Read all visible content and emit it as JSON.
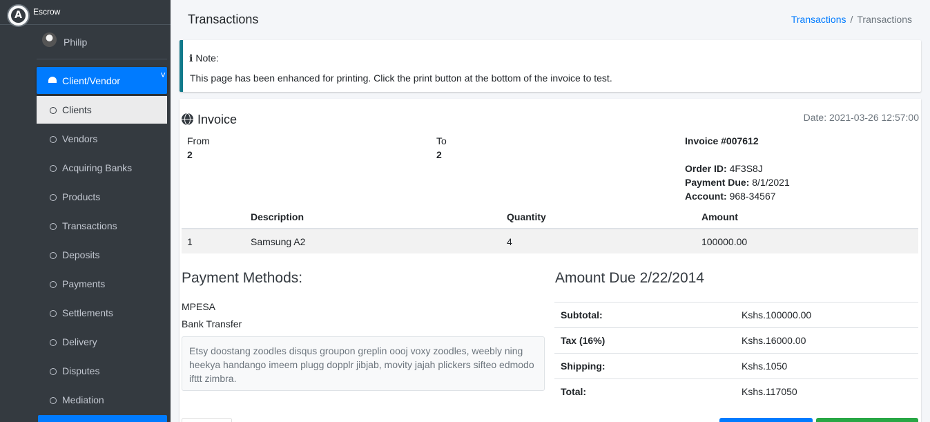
{
  "brand": {
    "name": "Escrow",
    "logo_letter": "A",
    "logo_icon": "app-logo-icon"
  },
  "user": {
    "name": "Philip",
    "avatar_icon": "user-avatar"
  },
  "nav": {
    "active": {
      "label": "Client/Vendor",
      "icon": "dashboard-gauge-icon",
      "chevron": "˅"
    },
    "items": [
      {
        "label": "Clients"
      },
      {
        "label": "Vendors"
      },
      {
        "label": "Acquiring Banks"
      },
      {
        "label": "Products"
      },
      {
        "label": "Transactions"
      },
      {
        "label": "Deposits"
      },
      {
        "label": "Payments"
      },
      {
        "label": "Settlements"
      },
      {
        "label": "Delivery"
      },
      {
        "label": "Disputes"
      },
      {
        "label": "Mediation"
      }
    ]
  },
  "header": {
    "title": "Transactions",
    "breadcrumb": {
      "link": "Transactions",
      "separator": "/",
      "current": "Transactions"
    }
  },
  "callout": {
    "icon": "info-icon",
    "icon_glyph": "i",
    "title": "Note:",
    "text": "This page has been enhanced for printing. Click the print button at the bottom of the invoice to test."
  },
  "invoice": {
    "title": "Invoice",
    "title_icon": "globe-icon",
    "date": "Date: 2021-03-26 12:57:00",
    "from_label": "From",
    "from_value": "2",
    "to_label": "To",
    "to_value": "2",
    "number": "Invoice #007612",
    "order_id_label": "Order ID:",
    "order_id": "4F3S8J",
    "payment_due_label": "Payment Due:",
    "payment_due": "8/1/2021",
    "account_label": "Account:",
    "account": "968-34567",
    "table": {
      "headers": [
        "",
        "Description",
        "Quantity",
        "Amount"
      ],
      "rows": [
        [
          "1",
          "Samsung A2",
          "4",
          "100000.00"
        ]
      ]
    }
  },
  "payment": {
    "title": "Payment Methods:",
    "methods": [
      "MPESA",
      "Bank Transfer"
    ],
    "note": "Etsy doostang zoodles disqus groupon greplin oooj voxy zoodles, weebly ning heekya handango imeem plugg dopplr jibjab, movity jajah plickers sifteo edmodo ifttt zimbra."
  },
  "amount_due": {
    "title": "Amount Due 2/22/2014",
    "rows": [
      {
        "label": "Subtotal:",
        "value": "Kshs.100000.00"
      },
      {
        "label": "Tax (16%)",
        "value": "Kshs.16000.00"
      },
      {
        "label": "Shipping:",
        "value": "Kshs.1050"
      },
      {
        "label": "Total:",
        "value": "Kshs.117050"
      }
    ]
  },
  "colors": {
    "sidebar": "#343a40",
    "primary": "#007bff",
    "success": "#28a745",
    "callout_border": "#117a8b"
  }
}
